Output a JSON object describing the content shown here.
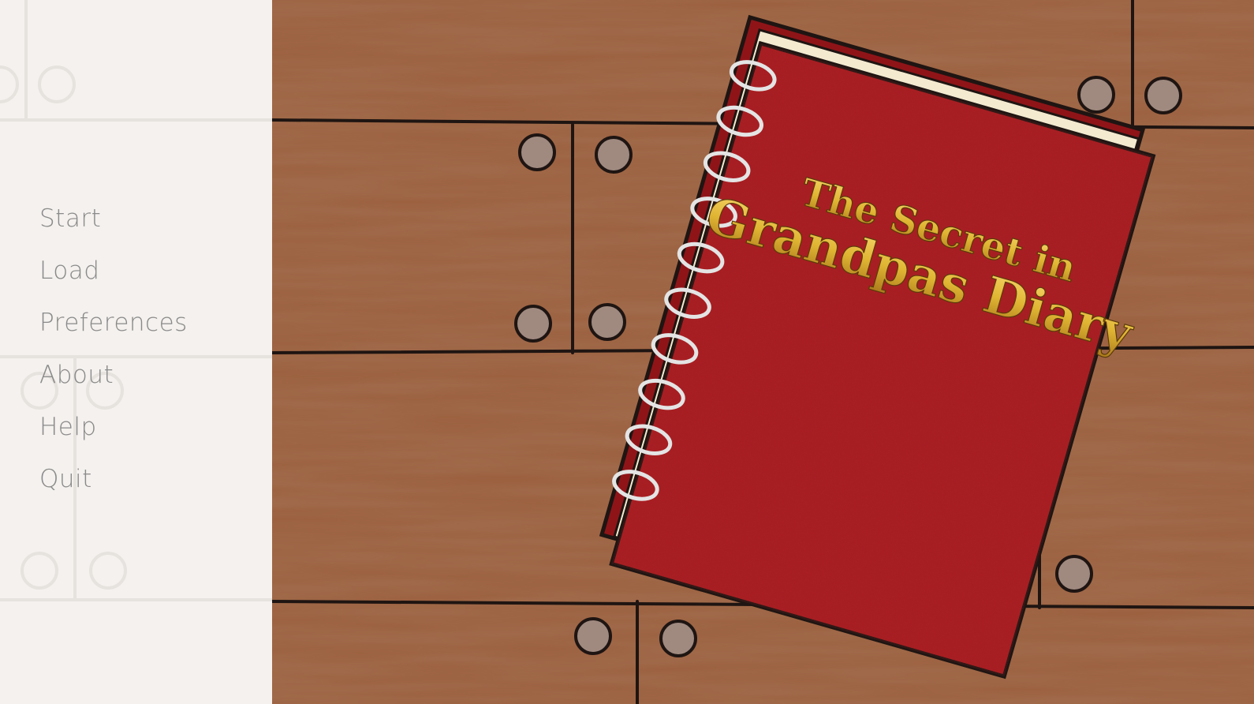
{
  "colors": {
    "wood": "#9b5f3e",
    "wood_dark": "#8e5535",
    "board_line": "#1f1512",
    "bolt": "#a08a80",
    "panel_bg": "#f4f1ee",
    "menu_text": "#8a8a8a",
    "book_red": "#a81c20",
    "book_gold": "#e0b533",
    "spiral": "#e4e4e4"
  },
  "menu": {
    "items": [
      {
        "id": "start",
        "label": "Start"
      },
      {
        "id": "load",
        "label": "Load"
      },
      {
        "id": "preferences",
        "label": "Preferences"
      },
      {
        "id": "about",
        "label": "About"
      },
      {
        "id": "help",
        "label": "Help"
      },
      {
        "id": "quit",
        "label": "Quit"
      }
    ]
  },
  "diary": {
    "title_line1": "The Secret in",
    "title_line2": "Grandpas Diary"
  }
}
